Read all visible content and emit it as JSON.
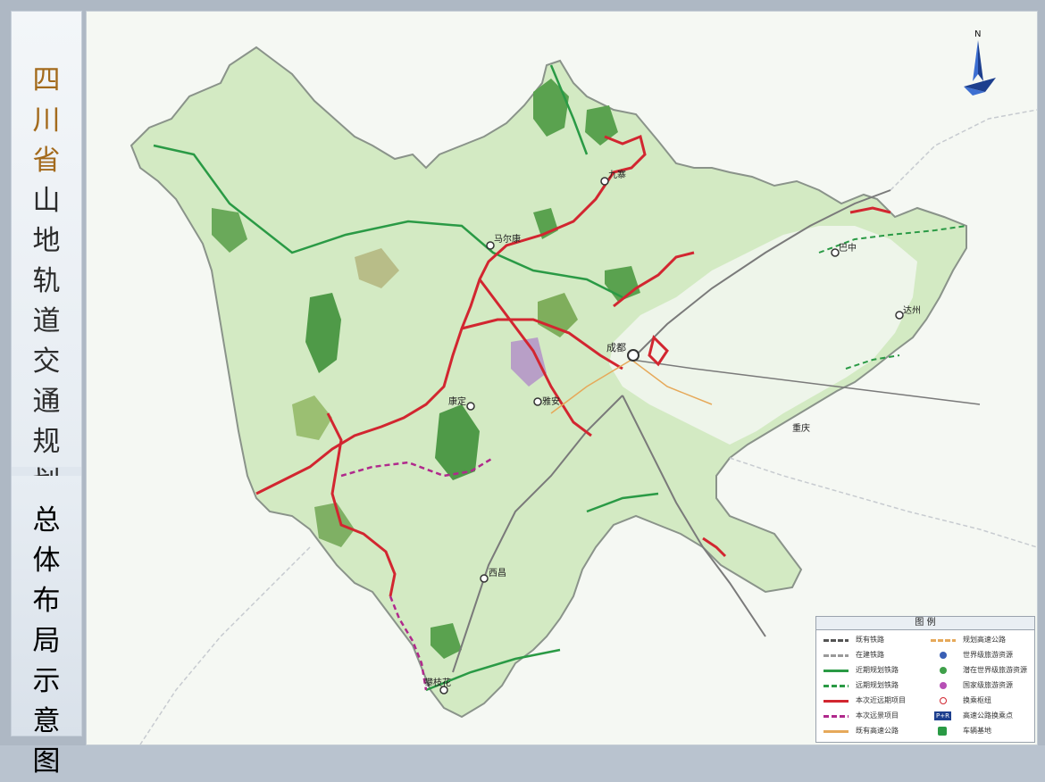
{
  "title": {
    "line1": [
      "四",
      "川",
      "省"
    ],
    "line2": [
      "山",
      "地",
      "轨",
      "道",
      "交",
      "通",
      "规",
      "划"
    ],
    "line3": [
      "总",
      "体",
      "布",
      "局",
      "示",
      "意",
      "图"
    ]
  },
  "compass": {
    "label": "N"
  },
  "map": {
    "place_labels": [
      {
        "name": "马尔康"
      },
      {
        "name": "成都"
      },
      {
        "name": "康定"
      },
      {
        "name": "雅安"
      },
      {
        "name": "西昌"
      },
      {
        "name": "攀枝花"
      },
      {
        "name": "巴中"
      },
      {
        "name": "达州"
      },
      {
        "name": "重庆"
      },
      {
        "name": "九寨"
      }
    ],
    "colors": {
      "province_fill": "#d6ebc6",
      "mountain_green": "#4f9a48",
      "plain_white": "#f1f6ee",
      "near_term_rail": "#2a9a45",
      "this_project": "#d22630",
      "this_future": "#b0298c",
      "expressway": "#e6a95a",
      "existing_rail": "#777777"
    }
  },
  "legend": {
    "title": "图 例",
    "items": [
      {
        "label": "既有铁路",
        "icon": "existing-rail-line"
      },
      {
        "label": "在建铁路",
        "icon": "construction-rail-line"
      },
      {
        "label": "近期规划铁路",
        "icon": "near-term-rail-line"
      },
      {
        "label": "远期规划铁路",
        "icon": "long-term-rail-line"
      },
      {
        "label": "本次近远期项目",
        "icon": "project-line"
      },
      {
        "label": "本次远景项目",
        "icon": "vision-project-line"
      },
      {
        "label": "既有高速公路",
        "icon": "existing-expressway-line"
      },
      {
        "label": "规划高速公路",
        "icon": "planned-expressway-line"
      },
      {
        "label": "世界级旅游资源",
        "icon": "world-tourism-icon"
      },
      {
        "label": "潜在世界级旅游资源",
        "icon": "potential-world-tourism-icon"
      },
      {
        "label": "国家级旅游资源",
        "icon": "national-tourism-icon"
      },
      {
        "label": "换乘枢纽",
        "icon": "transfer-hub-icon"
      },
      {
        "label": "高速公路换乘点",
        "icon": "pr-icon"
      },
      {
        "label": "车辆基地",
        "icon": "depot-icon"
      }
    ],
    "pr_badge": "P+R"
  }
}
